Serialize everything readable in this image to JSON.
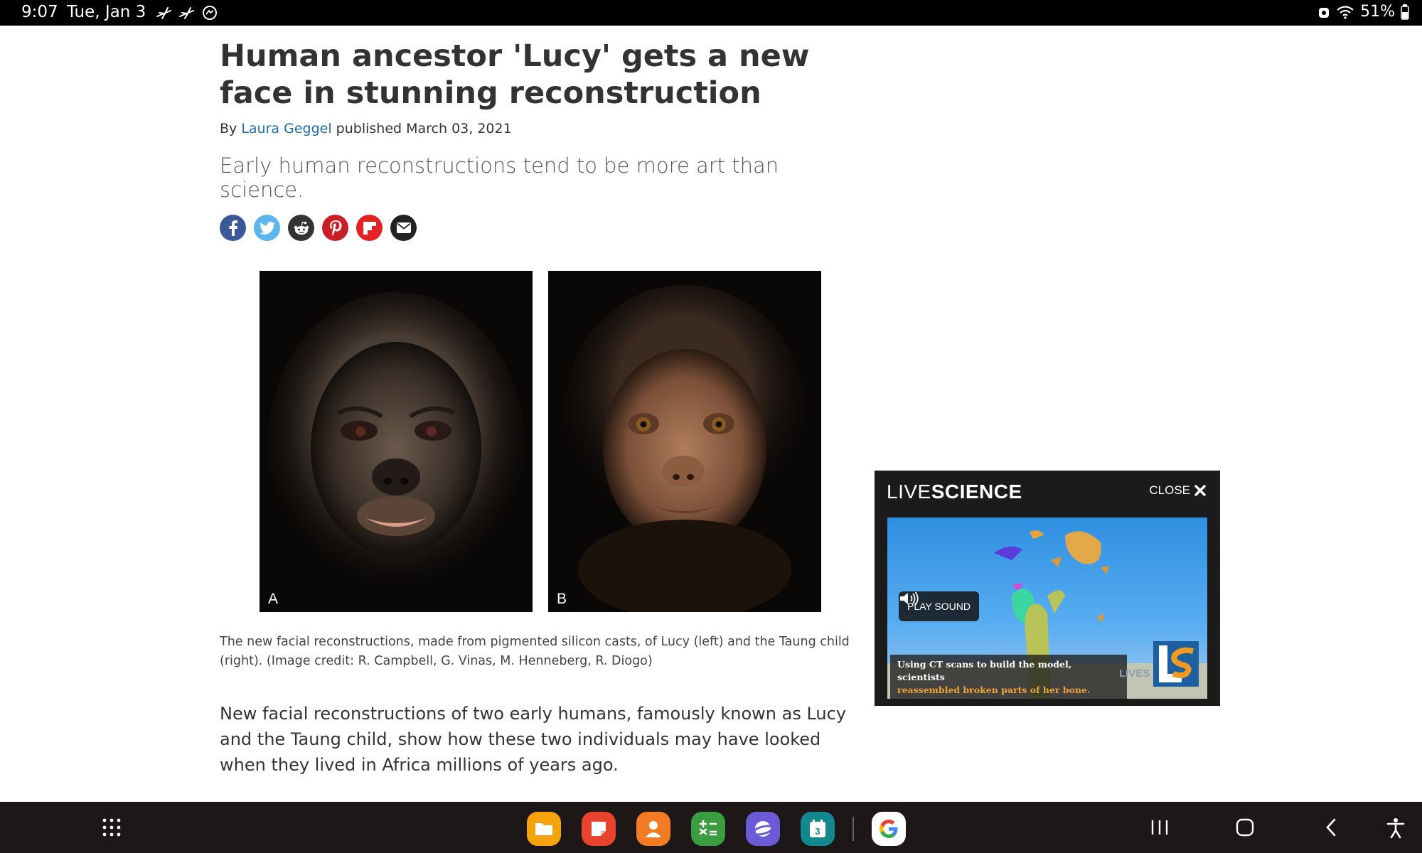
{
  "status_bar": {
    "time": "9:07",
    "date": "Tue, Jan 3",
    "battery": "51%",
    "notification_icons": [
      "airplane-icon",
      "airplane-icon",
      "messenger-icon"
    ]
  },
  "article": {
    "headline": "Human ancestor 'Lucy' gets a new face in stunning reconstruction",
    "byline_prefix": "By",
    "author": "Laura Geggel",
    "published": "published March 03, 2021",
    "standfirst": "Early human reconstructions tend to be more art than science.",
    "share": [
      {
        "name": "facebook",
        "color": "#3b5998",
        "glyph": "f"
      },
      {
        "name": "twitter",
        "color": "#4fb0ef",
        "glyph": "bird"
      },
      {
        "name": "reddit",
        "color": "#333333",
        "glyph": "alien"
      },
      {
        "name": "pinterest",
        "color": "#cb1f27",
        "glyph": "P"
      },
      {
        "name": "flipboard",
        "color": "#e32323",
        "glyph": "F"
      },
      {
        "name": "email",
        "color": "#222222",
        "glyph": "envelope"
      }
    ],
    "image_labels": {
      "left": "A",
      "right": "B"
    },
    "caption": "The new facial reconstructions, made from pigmented silicon casts, of Lucy (left) and the Taung child (right). (Image credit: R. Campbell, G. Vinas, M. Henneberg, R. Diogo)",
    "body": "New facial reconstructions of two early humans, famously known as Lucy and the Taung child, show how these two individuals may have looked when they lived in Africa millions of years ago."
  },
  "video_popup": {
    "logo_light": "LIVE",
    "logo_bold": "SCIENCE",
    "close_label": "CLOSE",
    "play_sound_label": "PLAY SOUND",
    "subtitle_line1": "Using CT scans to build the model, scientists",
    "subtitle_line2": "reassembled broken parts of her bone.",
    "badge_text": "LIVES"
  },
  "dock": {
    "apps": [
      {
        "name": "my-files",
        "color": "#f5a30c"
      },
      {
        "name": "samsung-notes",
        "color": "#e8432e"
      },
      {
        "name": "contacts",
        "color": "#f37b23"
      },
      {
        "name": "calculator",
        "color": "#3a9d3f"
      },
      {
        "name": "samsung-internet",
        "color": "#6b5bd7"
      },
      {
        "name": "calendar",
        "color": "#13888f",
        "label": "3"
      },
      {
        "name": "google",
        "color": "#ffffff"
      }
    ]
  }
}
